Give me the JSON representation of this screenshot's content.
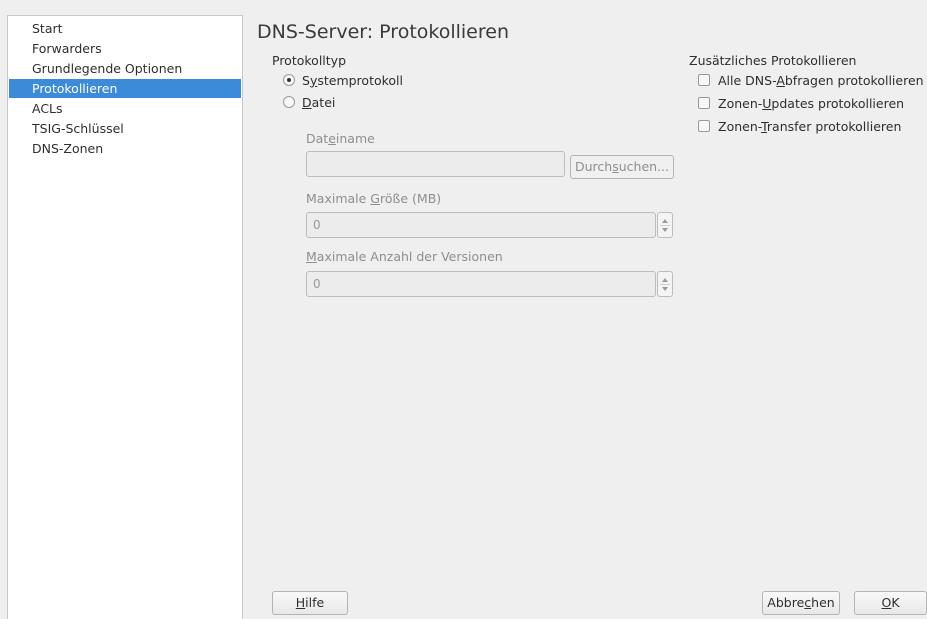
{
  "nav": {
    "items": [
      {
        "label": "Start"
      },
      {
        "label": "Forwarders"
      },
      {
        "label": "Grundlegende Optionen"
      },
      {
        "label": "Protokollieren",
        "active": true
      },
      {
        "label": "ACLs"
      },
      {
        "label": "TSIG-Schlüssel"
      },
      {
        "label": "DNS-Zonen"
      }
    ]
  },
  "page": {
    "title": "DNS-Server: Protokollieren"
  },
  "logging_type": {
    "label": "Protokolltyp",
    "options": [
      {
        "label_pre": "S",
        "label_u": "y",
        "label_post": "stemprotokoll",
        "checked": true
      },
      {
        "label_pre": "",
        "label_u": "D",
        "label_post": "atei",
        "checked": false
      }
    ]
  },
  "file": {
    "filename_label_pre": "Dat",
    "filename_label_u": "e",
    "filename_label_post": "iname",
    "filename_value": "",
    "browse_pre": "Durch",
    "browse_u": "s",
    "browse_post": "uchen...",
    "max_size_label_pre": "Maximale ",
    "max_size_label_u": "G",
    "max_size_label_post": "röße (MB)",
    "max_size_value": "0",
    "max_versions_label_pre": "",
    "max_versions_label_u": "M",
    "max_versions_label_post": "aximale Anzahl der Versionen",
    "max_versions_value": "0"
  },
  "additional": {
    "label": "Zusätzliches Protokollieren",
    "options": [
      {
        "pre": "Alle DNS-",
        "u": "A",
        "post": "bfragen protokollieren",
        "checked": false
      },
      {
        "pre": "Zonen-",
        "u": "U",
        "post": "pdates protokollieren",
        "checked": false
      },
      {
        "pre": "Zonen-",
        "u": "T",
        "post": "ransfer protokollieren",
        "checked": false
      }
    ]
  },
  "footer": {
    "help_u": "H",
    "help_post": "ilfe",
    "cancel_pre": "Abbre",
    "cancel_u": "c",
    "cancel_post": "hen",
    "ok_u": "O",
    "ok_post": "K"
  },
  "colors": {
    "accent": "#3b8bd9",
    "background": "#efefef"
  }
}
